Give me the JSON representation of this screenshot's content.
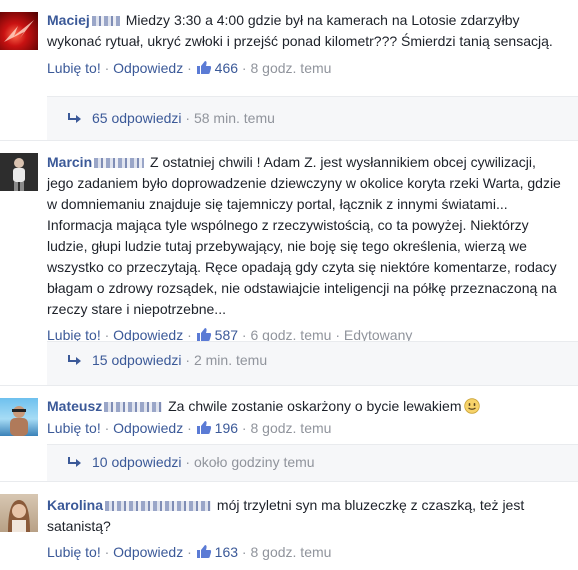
{
  "ui": {
    "like_label": "Lubię to!",
    "reply_label": "Odpowiedz",
    "separator": "·"
  },
  "comments": [
    {
      "author": "Maciej",
      "text": "Miedzy 3:30 a 4:00 gdzie był na kamerach na Lotosie zdarzyłby wykonać rytuał, ukryć zwłoki i przejść ponad kilometr??? Śmierdzi tanią sensacją.",
      "likes": "466",
      "time": "8 godz. temu",
      "replies_count": "65 odpowiedzi",
      "replies_time": "58 min. temu"
    },
    {
      "author": "Marcin",
      "text": "Z ostatniej chwili ! Adam Z. jest wysłannikiem obcej cywilizacji, jego zadaniem było doprowadzenie dziewczyny w okolice koryta rzeki Warta, gdzie w domniemaniu znajduje się tajemniczy portal, łącznik z innymi światami... Informacja mająca tyle wspólnego z rzeczywistością, co ta powyżej. Niektórzy ludzie, głupi ludzie tutaj przebywający, nie boję się tego określenia, wierzą we wszystko co przeczytają. Ręce opadają gdy czyta się niektóre komentarze, rodacy błagam o zdrowy rozsądek, nie odstawiajcie inteligencji na półkę przeznaczoną na rzeczy stare i niepotrzebne...",
      "likes": "587",
      "time": "6 godz. temu",
      "edited": "Edytowany",
      "replies_count": "15 odpowiedzi",
      "replies_time": "2 min. temu"
    },
    {
      "author": "Mateusz",
      "text": "Za chwile zostanie oskarżony o bycie lewakiem",
      "likes": "196",
      "time": "8 godz. temu",
      "replies_count": "10 odpowiedzi",
      "replies_time": "około godziny temu"
    },
    {
      "author": "Karolina",
      "text": "mój trzyletni syn ma bluzeczkę z czaszką, też jest satanistą?",
      "likes": "163",
      "time": "8 godz. temu"
    }
  ]
}
